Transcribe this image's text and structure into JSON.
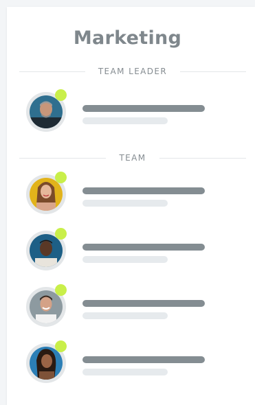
{
  "card": {
    "title": "Marketing",
    "leader_heading": "TEAM LEADER",
    "team_heading": "TEAM"
  },
  "leader": {
    "avatar_icon": "person-avatar-icon",
    "status_color": "#c9ef4a"
  },
  "team": [
    {
      "avatar_icon": "person-avatar-icon"
    },
    {
      "avatar_icon": "person-avatar-icon"
    },
    {
      "avatar_icon": "person-avatar-icon"
    },
    {
      "avatar_icon": "person-avatar-icon"
    }
  ],
  "colors": {
    "status_online": "#c9ef4a",
    "name_placeholder": "#848d92",
    "role_placeholder": "#e6eaed",
    "title": "#7f878c"
  }
}
